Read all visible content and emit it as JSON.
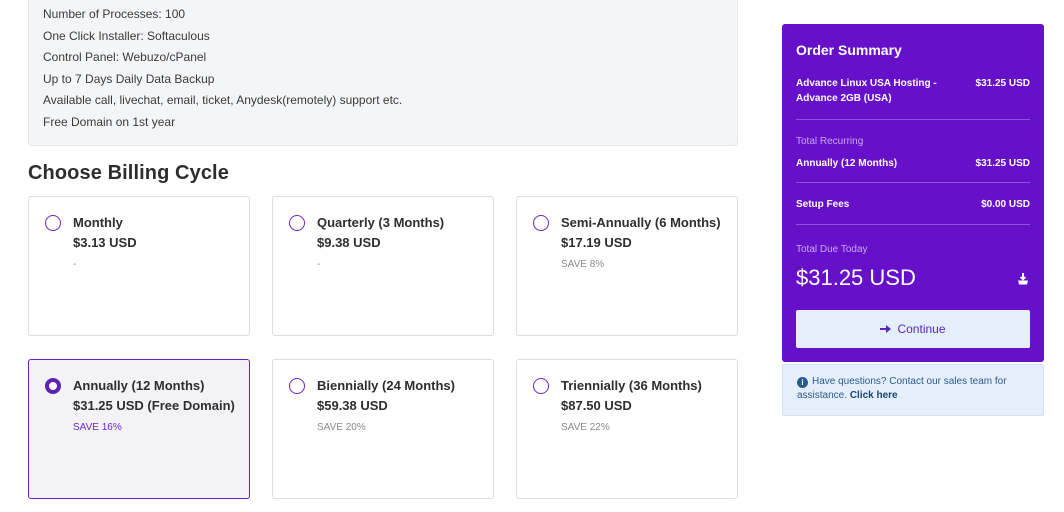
{
  "features": [
    "Number of Processes: 100",
    "One Click Installer: Softaculous",
    "Control Panel: Webuzo/cPanel",
    "Up to 7 Days Daily Data Backup",
    "Available call, livechat, email, ticket, Anydesk(remotely) support etc.",
    "Free Domain on 1st year"
  ],
  "billing": {
    "title": "Choose Billing Cycle",
    "selected_index": 3,
    "cycles": [
      {
        "name": "Monthly",
        "price": "$3.13 USD",
        "save": "-"
      },
      {
        "name": "Quarterly (3 Months)",
        "price": "$9.38 USD",
        "save": "-"
      },
      {
        "name": "Semi-Annually (6 Months)",
        "price": "$17.19 USD",
        "save": "SAVE 8%"
      },
      {
        "name": "Annually (12 Months)",
        "price": "$31.25 USD (Free Domain)",
        "save": "SAVE 16%"
      },
      {
        "name": "Biennially (24 Months)",
        "price": "$59.38 USD",
        "save": "SAVE 20%"
      },
      {
        "name": "Triennially (36 Months)",
        "price": "$87.50 USD",
        "save": "SAVE 22%"
      }
    ]
  },
  "summary": {
    "title": "Order Summary",
    "product_name": "Advance Linux USA Hosting - Advance 2GB (USA)",
    "product_price": "$31.25 USD",
    "recurring_label": "Total Recurring",
    "recurring_cycle": "Annually (12 Months)",
    "recurring_price": "$31.25 USD",
    "setup_label": "Setup Fees",
    "setup_price": "$0.00 USD",
    "due_label": "Total Due Today",
    "due_amount": "$31.25 USD",
    "continue_label": "Continue"
  },
  "help": {
    "text": "Have questions? Contact our sales team for assistance.",
    "link": "Click here"
  },
  "colors": {
    "accent": "#6610c9",
    "selected_border": "#6a1fc9",
    "help_bg": "#e4effb"
  }
}
